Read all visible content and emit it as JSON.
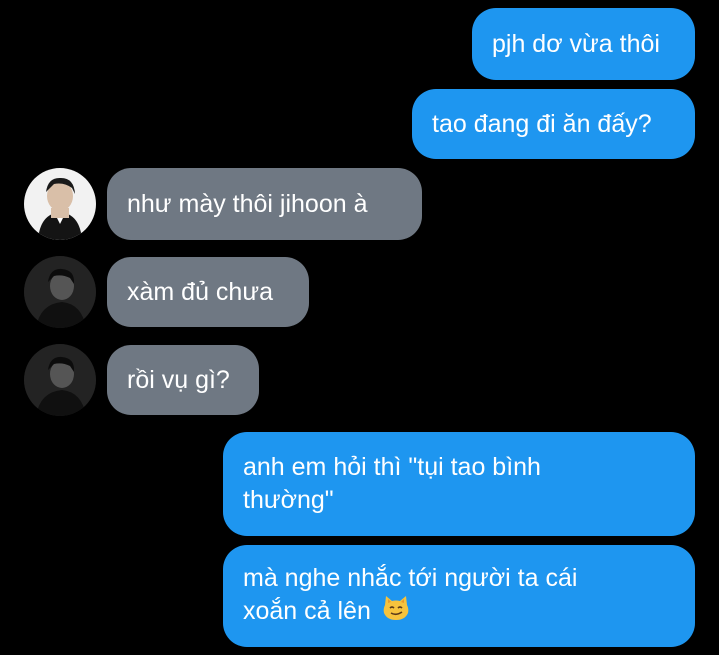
{
  "messages": [
    {
      "id": "m1",
      "direction": "outgoing",
      "text": "pjh dơ vừa thôi"
    },
    {
      "id": "m2",
      "direction": "outgoing",
      "text": "tao đang đi ăn đấy?"
    },
    {
      "id": "m3",
      "direction": "incoming",
      "text": "như mày thôi jihoon à"
    },
    {
      "id": "m4",
      "direction": "incoming",
      "text": "xàm đủ chưa"
    },
    {
      "id": "m5",
      "direction": "incoming",
      "text": "rồi vụ gì?"
    },
    {
      "id": "m6",
      "direction": "outgoing",
      "text": "anh em hỏi thì \"tụi tao bình thường\""
    },
    {
      "id": "m7",
      "direction": "outgoing",
      "text": "mà nghe nhắc tới người ta cái xoắn cả lên",
      "emoji": "smirking-cat-emoji"
    }
  ],
  "colors": {
    "background": "#000000",
    "outgoing_bubble": "#1e96f0",
    "incoming_bubble": "#6f7883",
    "text": "#ffffff"
  }
}
